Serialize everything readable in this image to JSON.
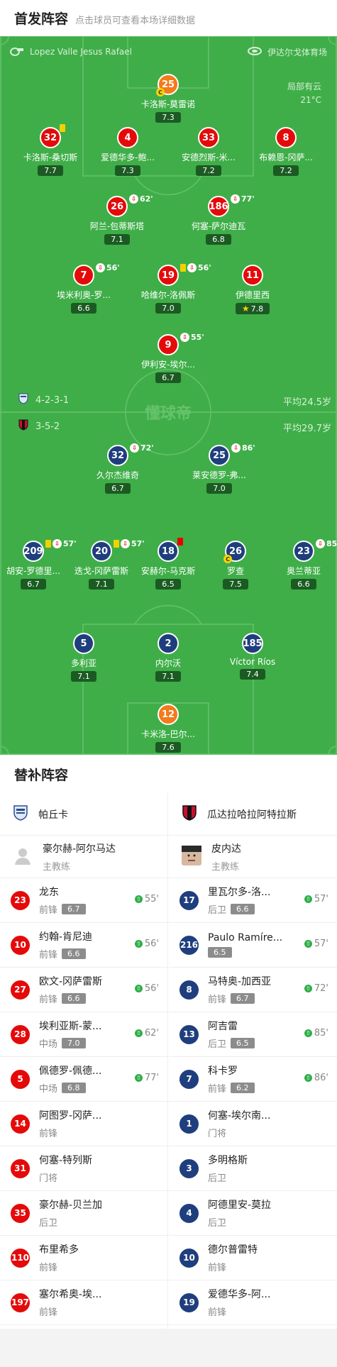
{
  "header": {
    "title": "首发阵容",
    "subtitle": "点击球员可查看本场详细数据"
  },
  "pitch": {
    "referee": "Lopez Valle Jesus Rafael",
    "stadium": "伊达尔戈体育场",
    "weather": "局部有云",
    "temp": "21°C",
    "watermark": "懂球帝",
    "home_formation": "4-2-3-1",
    "home_avg": "平均24.5岁",
    "away_formation": "3-5-2",
    "away_avg": "平均29.7岁"
  },
  "colors": {
    "pitch": "#3fae48",
    "home": "#e50a0a",
    "away": "#1f3e7d",
    "gk_home": "#f47a1b",
    "gk_away": "#f47a1b"
  },
  "home_players": [
    {
      "num": "25",
      "name": "卡洛斯-莫雷诺",
      "rating": "7.3",
      "captain": "C"
    },
    {
      "num": "32",
      "name": "卡洛斯-桑切斯",
      "rating": "7.7"
    },
    {
      "num": "4",
      "name": "爱德华多-鲍...",
      "rating": "7.3"
    },
    {
      "num": "33",
      "name": "安德烈斯-米...",
      "rating": "7.2"
    },
    {
      "num": "8",
      "name": "布赖恩-冈萨...",
      "rating": "7.2"
    },
    {
      "num": "26",
      "name": "阿兰-包蒂斯塔",
      "rating": "7.1",
      "min": "62'"
    },
    {
      "num": "186",
      "name": "何塞-萨尔迪瓦",
      "rating": "6.8",
      "min": "77'"
    },
    {
      "num": "7",
      "name": "埃米利奥-罗...",
      "rating": "6.6",
      "min": "56'"
    },
    {
      "num": "19",
      "name": "哈维尔-洛佩斯",
      "rating": "7.0",
      "min": "56'"
    },
    {
      "num": "11",
      "name": "伊德里西",
      "rating": "7.8"
    },
    {
      "num": "9",
      "name": "伊利安-埃尔...",
      "rating": "6.7",
      "min": "55'"
    }
  ],
  "away_players": [
    {
      "num": "32",
      "name": "久尔杰维奇",
      "rating": "6.7",
      "min": "72'"
    },
    {
      "num": "25",
      "name": "莱安德罗-弗...",
      "rating": "7.0",
      "min": "86'"
    },
    {
      "num": "209",
      "name": "胡安-罗德里...",
      "rating": "6.7",
      "min": "57'"
    },
    {
      "num": "20",
      "name": "迭戈-冈萨雷斯",
      "rating": "7.1",
      "min": "57'"
    },
    {
      "num": "18",
      "name": "安赫尔-马克斯",
      "rating": "6.5"
    },
    {
      "num": "26",
      "name": "罗查",
      "rating": "7.5",
      "captain": "C"
    },
    {
      "num": "23",
      "name": "奥兰蒂亚",
      "rating": "6.6",
      "min": "85'"
    },
    {
      "num": "5",
      "name": "多利亚",
      "rating": "7.1"
    },
    {
      "num": "2",
      "name": "内尔沃",
      "rating": "7.1"
    },
    {
      "num": "185",
      "name": "Víctor Ríos",
      "rating": "7.4"
    },
    {
      "num": "12",
      "name": "卡米洛-巴尔...",
      "rating": "7.6"
    }
  ],
  "subs": {
    "title": "替补阵容",
    "home": {
      "team": "帕丘卡",
      "coach": "豪尔赫-阿尔马达",
      "coach_role": "主教练",
      "players": [
        {
          "num": "23",
          "name": "龙东",
          "pos": "前锋",
          "rating": "6.7",
          "min": "55'"
        },
        {
          "num": "10",
          "name": "约翰-肯尼迪",
          "pos": "前锋",
          "rating": "6.6",
          "min": "56'"
        },
        {
          "num": "27",
          "name": "欧文-冈萨雷斯",
          "pos": "前锋",
          "rating": "6.6",
          "min": "56'"
        },
        {
          "num": "28",
          "name": "埃利亚斯-蒙...",
          "pos": "中场",
          "rating": "7.0",
          "min": "62'"
        },
        {
          "num": "5",
          "name": "佩德罗-佩德...",
          "pos": "中场",
          "rating": "6.8",
          "min": "77'"
        },
        {
          "num": "14",
          "name": "阿图罗-冈萨...",
          "pos": "前锋"
        },
        {
          "num": "31",
          "name": "何塞-特列斯",
          "pos": "门将"
        },
        {
          "num": "35",
          "name": "豪尔赫-贝兰加",
          "pos": "后卫"
        },
        {
          "num": "110",
          "name": "布里希多",
          "pos": "前锋"
        },
        {
          "num": "197",
          "name": "塞尔希奥-埃...",
          "pos": "前锋"
        }
      ]
    },
    "away": {
      "team": "瓜达拉哈拉阿特拉斯",
      "coach": "皮内达",
      "coach_role": "主教练",
      "players": [
        {
          "num": "17",
          "name": "里瓦尔多-洛...",
          "pos": "后卫",
          "rating": "6.6",
          "min": "57'"
        },
        {
          "num": "216",
          "name": "Paulo Ramíre...",
          "pos": "",
          "rating": "6.5",
          "min": "57'"
        },
        {
          "num": "8",
          "name": "马特奥-加西亚",
          "pos": "前锋",
          "rating": "6.7",
          "min": "72'"
        },
        {
          "num": "13",
          "name": "阿吉雷",
          "pos": "后卫",
          "rating": "6.5",
          "min": "85'"
        },
        {
          "num": "7",
          "name": "科卡罗",
          "pos": "前锋",
          "rating": "6.2",
          "min": "86'"
        },
        {
          "num": "1",
          "name": "何塞-埃尔南...",
          "pos": "门将"
        },
        {
          "num": "3",
          "name": "多明格斯",
          "pos": "后卫"
        },
        {
          "num": "4",
          "name": "阿德里安-莫拉",
          "pos": "后卫"
        },
        {
          "num": "10",
          "name": "德尔普雷特",
          "pos": "前锋"
        },
        {
          "num": "19",
          "name": "爱德华多-阿...",
          "pos": "前锋"
        }
      ]
    }
  }
}
